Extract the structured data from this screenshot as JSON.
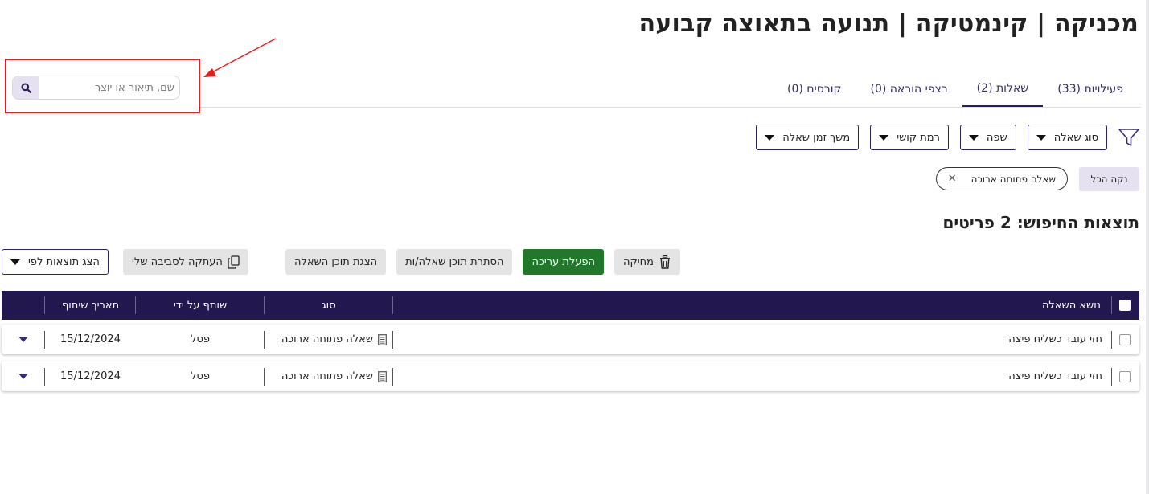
{
  "page": {
    "title": "מכניקה | קינמטיקה | תנועה בתאוצה קבועה"
  },
  "search": {
    "placeholder": "שם, תיאור או יוצר",
    "value": ""
  },
  "tabs": [
    {
      "label": "פעילויות (33)",
      "active": false
    },
    {
      "label": "שאלות (2)",
      "active": true
    },
    {
      "label": "רצפי הוראה (0)",
      "active": false
    },
    {
      "label": "קורסים (0)",
      "active": false
    }
  ],
  "filters": {
    "question_type": "סוג שאלה",
    "language": "שפה",
    "difficulty": "רמת קושי",
    "duration": "משך זמן שאלה"
  },
  "active_filters": {
    "clear_all": "נקה הכל",
    "chips": [
      {
        "label": "שאלה פתוחה ארוכה"
      }
    ]
  },
  "results": {
    "title": "תוצאות החיפוש: 2 פריטים"
  },
  "actions": {
    "delete": "מחיקה",
    "enable_edit": "הפעלת עריכה",
    "hide_content": "הסתרת תוכן שאלה/ות",
    "show_content": "הצגת תוכן השאלה",
    "copy_to_env": "העתקה לסביבה שלי",
    "show_by": "הצג תוצאות לפי"
  },
  "table": {
    "headers": {
      "topic": "נושא השאלה",
      "type": "סוג",
      "shared_by": "שותף על ידי",
      "share_date": "תאריך שיתוף"
    },
    "rows": [
      {
        "topic": "חזי עובד כשליח פיצה",
        "type": "שאלה פתוחה ארוכה",
        "shared_by": "פטל",
        "date": "15/12/2024"
      },
      {
        "topic": "חזי עובד כשליח פיצה",
        "type": "שאלה פתוחה ארוכה",
        "shared_by": "פטל",
        "date": "15/12/2024"
      }
    ]
  },
  "icons": {
    "search": "search-icon",
    "filter": "filter-icon",
    "trash": "trash-icon",
    "copy": "copy-icon",
    "question_type": "document-icon",
    "caret": "caret-down-icon",
    "close": "close-icon"
  },
  "colors": {
    "brand_dark": "#22174f",
    "accent_light": "#e5e1f0",
    "success": "#22782a",
    "annotation": "#e41f1f"
  }
}
